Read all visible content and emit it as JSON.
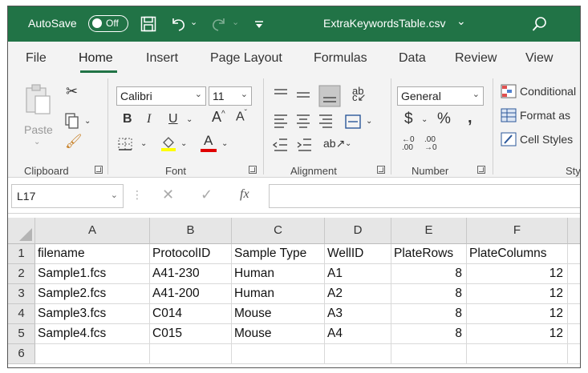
{
  "titlebar": {
    "autosave_label": "AutoSave",
    "autosave_state": "Off",
    "filename": "ExtraKeywordsTable.csv",
    "filename_chevron": "⌄",
    "brand_color": "#217346"
  },
  "tabs": [
    "File",
    "Home",
    "Insert",
    "Page Layout",
    "Formulas",
    "Data",
    "Review",
    "View"
  ],
  "active_tab": "Home",
  "ribbon": {
    "clipboard": {
      "label": "Clipboard",
      "paste_label": "Paste"
    },
    "font": {
      "label": "Font",
      "font_name": "Calibri",
      "font_size": "11"
    },
    "alignment": {
      "label": "Alignment"
    },
    "number": {
      "label": "Number",
      "format": "General"
    },
    "styles": {
      "label": "Sty",
      "conditional": "Conditional",
      "format_as": "Format as",
      "cell_styles": "Cell Styles"
    }
  },
  "formula_bar": {
    "name_box": "L17",
    "fx": "fx",
    "value": ""
  },
  "sheet": {
    "columns": [
      "A",
      "B",
      "C",
      "D",
      "E",
      "F"
    ],
    "rows": [
      [
        "filename",
        "ProtocolID",
        "Sample Type",
        "WellID",
        "PlateRows",
        "PlateColumns"
      ],
      [
        "Sample1.fcs",
        "A41-230",
        "Human",
        "A1",
        "8",
        "12"
      ],
      [
        "Sample2.fcs",
        "A41-200",
        "Human",
        "A2",
        "8",
        "12"
      ],
      [
        "Sample3.fcs",
        "C014",
        "Mouse",
        "A3",
        "8",
        "12"
      ],
      [
        "Sample4.fcs",
        "C015",
        "Mouse",
        "A4",
        "8",
        "12"
      ],
      [
        "",
        "",
        "",
        "",
        "",
        ""
      ]
    ],
    "row_numbers": [
      "1",
      "2",
      "3",
      "4",
      "5",
      "6"
    ]
  }
}
